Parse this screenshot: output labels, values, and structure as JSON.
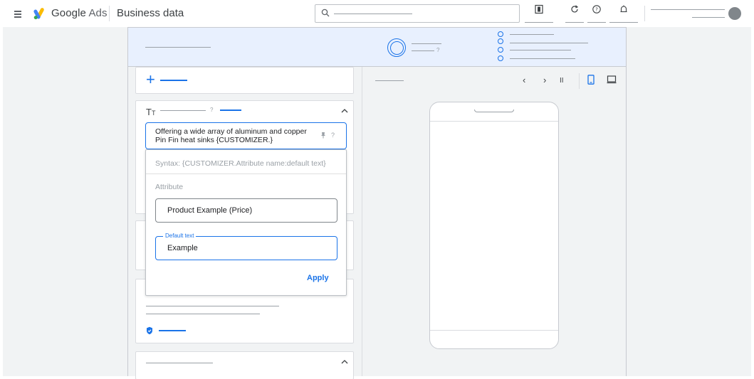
{
  "header": {
    "brand_google": "Google",
    "brand_ads": "Ads",
    "page_title": "Business data"
  },
  "editor": {
    "headline_value": "Offering a wide array of aluminum and copper Pin Fin heat sinks {CUSTOMIZER.}",
    "expand_glyph": "^",
    "pin_glyph": "📌",
    "help_glyph": "?"
  },
  "customizer_popup": {
    "syntax_hint": "Syntax: {CUSTOMIZER.Attribute name:default text}",
    "attribute_label": "Attribute",
    "attribute_value": "Product Example (Price)",
    "default_text_label": "Default text",
    "default_text_value": "Example",
    "apply_label": "Apply"
  },
  "preview": {
    "prev_glyph": "‹",
    "next_glyph": "›",
    "pause_glyph": "II"
  },
  "colors": {
    "accent": "#1a73e8",
    "banner_bg": "#e8f0fe",
    "canvas_bg": "#f1f3f4"
  },
  "icons": [
    "menu-icon",
    "google-ads-logo",
    "search-icon",
    "reports-icon",
    "refresh-icon",
    "help-icon",
    "notifications-icon",
    "avatar",
    "text-format-icon",
    "pin-icon",
    "shield-icon",
    "chevron-left-icon",
    "chevron-right-icon",
    "pause-icon",
    "mobile-icon",
    "desktop-icon"
  ]
}
